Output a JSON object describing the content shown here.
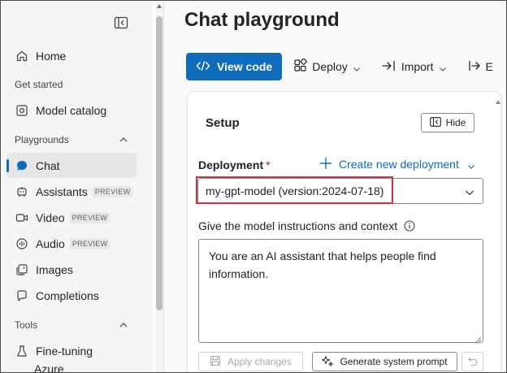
{
  "sidebar": {
    "home": "Home",
    "get_started_heading": "Get started",
    "model_catalog": "Model catalog",
    "playgrounds_heading": "Playgrounds",
    "items": [
      {
        "label": "Chat",
        "badge": "",
        "icon": "chat-icon",
        "active": true
      },
      {
        "label": "Assistants",
        "badge": "PREVIEW",
        "icon": "assistants-icon",
        "active": false
      },
      {
        "label": "Video",
        "badge": "PREVIEW",
        "icon": "video-icon",
        "active": false
      },
      {
        "label": "Audio",
        "badge": "PREVIEW",
        "icon": "audio-icon",
        "active": false
      },
      {
        "label": "Images",
        "badge": "",
        "icon": "images-icon",
        "active": false
      },
      {
        "label": "Completions",
        "badge": "",
        "icon": "completions-icon",
        "active": false
      }
    ],
    "tools_heading": "Tools",
    "fine_tuning": "Fine-tuning",
    "cut_off_item": "Azure"
  },
  "page": {
    "title": "Chat playground"
  },
  "toolbar": {
    "view_code": "View code",
    "deploy": "Deploy",
    "import": "Import",
    "export_partial": "E"
  },
  "setup": {
    "title": "Setup",
    "hide": "Hide",
    "deployment_label": "Deployment",
    "required_marker": "*",
    "create_new_deployment": "Create new deployment",
    "deployment_value": "my-gpt-model (version:2024-07-18)",
    "instructions_label": "Give the model instructions and context",
    "instructions_value": "You are an AI assistant that helps people find information.",
    "apply_changes": "Apply changes",
    "generate_system_prompt": "Generate system prompt"
  },
  "colors": {
    "accent": "#0f6cbd",
    "highlight_box": "#d13438",
    "required": "#c50f1f"
  }
}
